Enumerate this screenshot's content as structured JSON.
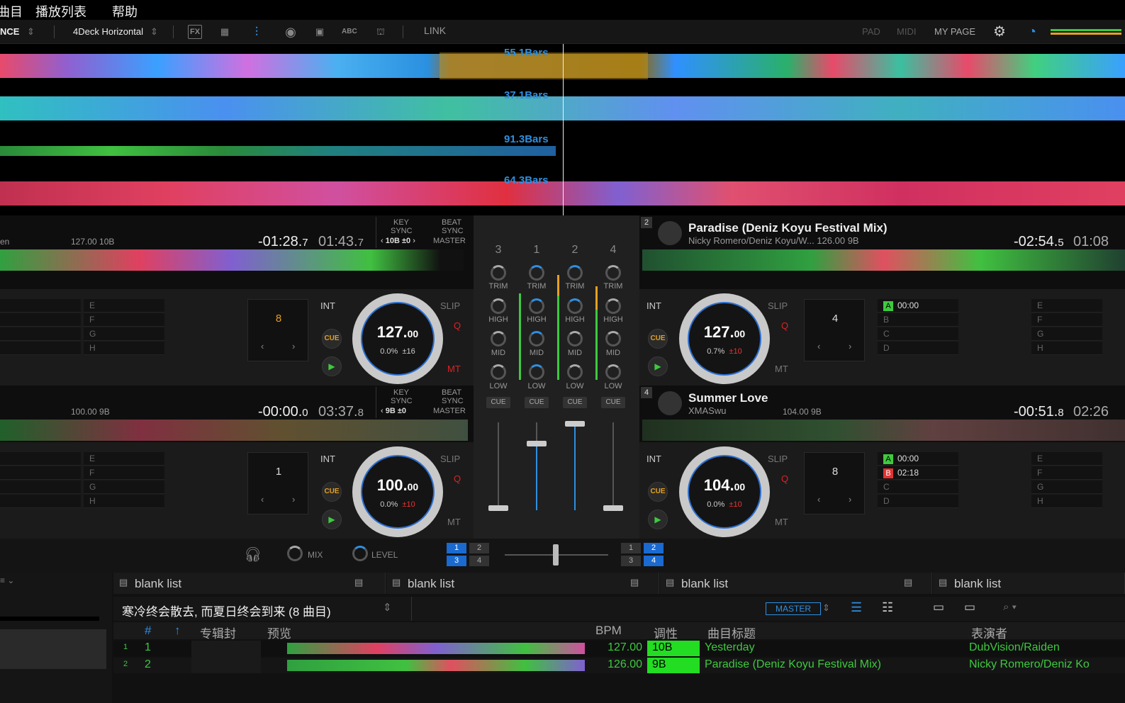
{
  "menu": {
    "items": [
      "曲目",
      "播放列表",
      "帮助"
    ]
  },
  "toolbar": {
    "mode": "NCE",
    "layout": "4Deck Horizontal",
    "link": "LINK",
    "pad": "PAD",
    "midi": "MIDI",
    "mypage": "MY PAGE",
    "fx": "FX",
    "abc": "ABC"
  },
  "waveform": {
    "deck3_bars": "55.1Bars",
    "deck1_bars": "37.1Bars",
    "deck2_bars": "91.3Bars",
    "deck4_bars": "64.3Bars"
  },
  "deck_top_left": {
    "info": "en",
    "bpm_key": "127.00  10B",
    "remain": "-01:28.",
    "remain_dec": "7",
    "elapsed": "01:43.",
    "elapsed_dec": "7",
    "key_label": "KEY",
    "sync_label": "SYNC",
    "key_val": "10B",
    "key_offset": "±0",
    "beat_label": "BEAT",
    "beat_sync": "SYNC",
    "master": "MASTER",
    "loop": "8",
    "jog_bpm": "127.",
    "jog_bpm_dec": "00",
    "jog_pitch": "0.0%",
    "jog_range": "±16",
    "int": "INT",
    "slip": "SLIP",
    "q": "Q",
    "mt": "MT",
    "cue": "CUE",
    "cues": [
      "E",
      "F",
      "G",
      "H"
    ]
  },
  "deck_top_right": {
    "num": "2",
    "title": "Paradise (Deniz Koyu Festival Mix)",
    "artist_bpm": "Nicky Romero/Deniz Koyu/W...  126.00  9B",
    "remain": "-02:54.",
    "remain_dec": "5",
    "elapsed": "01:08",
    "loop": "4",
    "jog_bpm": "127.",
    "jog_bpm_dec": "00",
    "jog_pitch": "0.7%",
    "jog_range": "±10",
    "int": "INT",
    "slip": "SLIP",
    "q": "Q",
    "mt": "MT",
    "cue": "CUE",
    "cue_a": "A",
    "cue_a_time": "00:00",
    "cues_left": [
      "B",
      "C",
      "D"
    ],
    "cues_right": [
      "E",
      "F",
      "G",
      "H"
    ]
  },
  "deck_bot_left": {
    "bpm_key": "100.00  9B",
    "remain": "-00:00.",
    "remain_dec": "0",
    "elapsed": "03:37.",
    "elapsed_dec": "8",
    "key_label": "KEY",
    "sync_label": "SYNC",
    "key_val": "9B",
    "key_offset": "±0",
    "beat_label": "BEAT",
    "beat_sync": "SYNC",
    "master": "MASTER",
    "loop": "1",
    "jog_bpm": "100.",
    "jog_bpm_dec": "00",
    "jog_pitch": "0.0%",
    "jog_range": "±10",
    "int": "INT",
    "slip": "SLIP",
    "q": "Q",
    "mt": "MT",
    "cue": "CUE",
    "cues": [
      "E",
      "F",
      "G",
      "H"
    ]
  },
  "deck_bot_right": {
    "num": "4",
    "title": "Summer Love",
    "artist": "XMASwu",
    "bpm_key": "104.00  9B",
    "remain": "-00:51.",
    "remain_dec": "8",
    "elapsed": "02:26",
    "loop": "8",
    "jog_bpm": "104.",
    "jog_bpm_dec": "00",
    "jog_pitch": "0.0%",
    "jog_range": "±10",
    "int": "INT",
    "slip": "SLIP",
    "q": "Q",
    "mt": "MT",
    "cue": "CUE",
    "cue_a": "A",
    "cue_a_time": "00:00",
    "cue_b": "B",
    "cue_b_time": "02:18",
    "cues_left": [
      "C",
      "D"
    ],
    "cues_right": [
      "E",
      "F",
      "G",
      "H"
    ]
  },
  "mixer": {
    "channels": [
      "3",
      "1",
      "2",
      "4"
    ],
    "trim": "TRIM",
    "high": "HIGH",
    "mid": "MID",
    "low": "LOW",
    "cue": "CUE"
  },
  "bottom": {
    "mix": "MIX",
    "level": "LEVEL",
    "assign_left": [
      "1",
      "2",
      "3",
      "4"
    ],
    "assign_right": [
      "1",
      "2",
      "3",
      "4"
    ]
  },
  "browser": {
    "tabs": [
      "blank list",
      "blank list",
      "blank list",
      "blank list"
    ],
    "playlist_title": "寒冷终会散去, 而夏日终会到来 (8 曲目)",
    "master": "MASTER",
    "columns": {
      "num": "#",
      "art": "专辑封",
      "preview": "预览",
      "bpm": "BPM",
      "key": "调性",
      "title": "曲目标题",
      "artist": "表演者"
    },
    "rows": [
      {
        "idx": "1",
        "num": "1",
        "bpm": "127.00",
        "key": "10B",
        "title": "Yesterday",
        "artist": "DubVision/Raiden"
      },
      {
        "idx": "2",
        "num": "2",
        "bpm": "126.00",
        "key": "9B",
        "title": "Paradise (Deniz Koyu Festival Mix)",
        "artist": "Nicky Romero/Deniz Ko"
      }
    ]
  },
  "colors": {
    "accent": "#2f8fe0",
    "green": "#3ec93e",
    "red": "#e33333",
    "orange": "#e5a020",
    "key_bg": "#22dd22"
  }
}
